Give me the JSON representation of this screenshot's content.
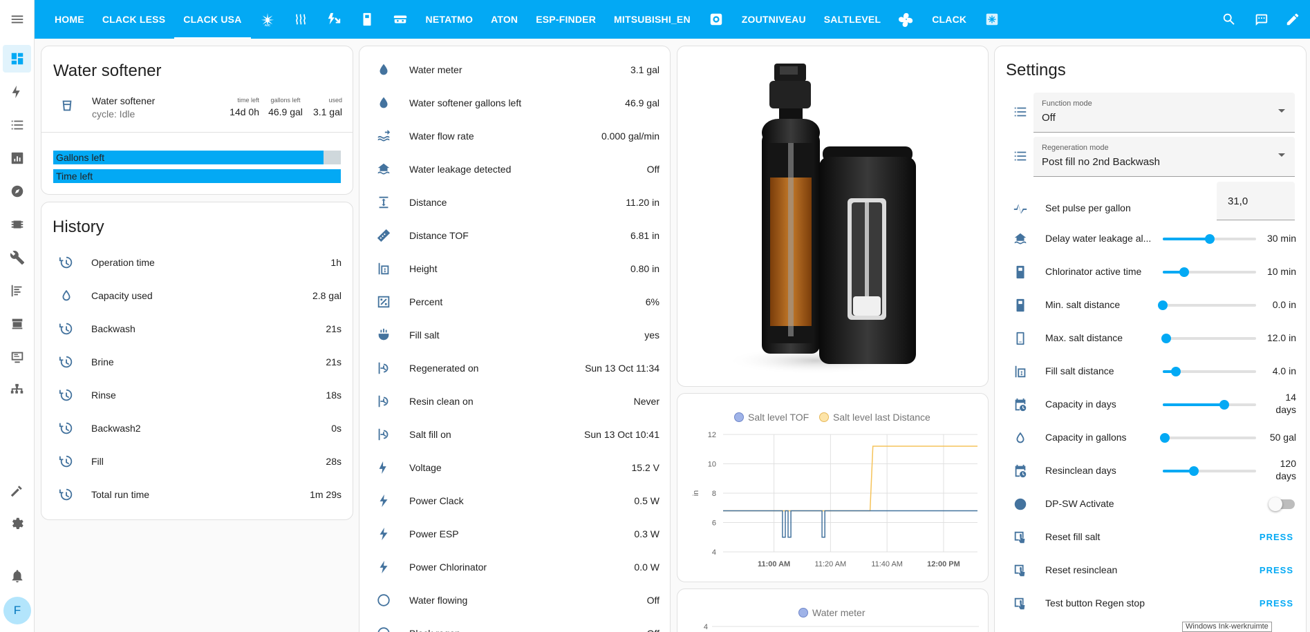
{
  "colors": {
    "accent": "#03a9f4",
    "icon": "#44739e",
    "series_tof": "#7aa6d8",
    "series_distance": "#f5c35a"
  },
  "tabs": [
    {
      "label": "HOME"
    },
    {
      "label": "CLACK LESS"
    },
    {
      "label": "CLACK USA",
      "active": true
    },
    {
      "icon": "ac-icon"
    },
    {
      "icon": "heating-icon"
    },
    {
      "icon": "power-icon"
    },
    {
      "icon": "device-icon"
    },
    {
      "icon": "robot-icon"
    },
    {
      "label": "NETATMO"
    },
    {
      "label": "ATON"
    },
    {
      "label": "ESP-FINDER"
    },
    {
      "label": "MITSUBISHI_EN"
    },
    {
      "icon": "camera-icon"
    },
    {
      "label": "ZOUTNIVEAU"
    },
    {
      "label": "SALTLEVEL"
    },
    {
      "icon": "fan-icon"
    },
    {
      "label": "CLACK"
    },
    {
      "icon": "box-icon"
    }
  ],
  "toolbar_icons": [
    "search-icon",
    "assist-icon",
    "edit-icon"
  ],
  "sidebar": {
    "items": [
      "dashboard-icon",
      "energy-icon",
      "logbook-icon",
      "history-icon",
      "map-icon",
      "esphome-icon",
      "tools-icon",
      "log-icon",
      "hacs-icon",
      "terminal-icon",
      "network-icon"
    ],
    "bottom": [
      "developer-tools-icon",
      "settings-icon",
      "notifications-icon"
    ],
    "avatar_initial": "F"
  },
  "water_softener": {
    "title": "Water softener",
    "entity_name": "Water softener",
    "cycle": "cycle: Idle",
    "stats": [
      {
        "label": "time left",
        "value": "14d 0h"
      },
      {
        "label": "gallons left",
        "value": "46.9 gal"
      },
      {
        "label": "used",
        "value": "3.1 gal"
      }
    ],
    "bars": [
      {
        "label": "Gallons left",
        "fraction": 0.94
      },
      {
        "label": "Time left",
        "fraction": 1.0
      }
    ]
  },
  "history": {
    "title": "History",
    "rows": [
      {
        "name": "Operation time",
        "value": "1h",
        "icon": "clock-icon"
      },
      {
        "name": "Capacity used",
        "value": "2.8 gal",
        "icon": "water-percent-icon"
      },
      {
        "name": "Backwash",
        "value": "21s",
        "icon": "clock-icon"
      },
      {
        "name": "Brine",
        "value": "21s",
        "icon": "clock-icon"
      },
      {
        "name": "Rinse",
        "value": "18s",
        "icon": "clock-icon"
      },
      {
        "name": "Backwash2",
        "value": "0s",
        "icon": "clock-icon"
      },
      {
        "name": "Fill",
        "value": "28s",
        "icon": "clock-icon"
      },
      {
        "name": "Total run time",
        "value": "1m 29s",
        "icon": "clock-icon"
      }
    ]
  },
  "sensors": [
    {
      "name": "Water meter",
      "value": "3.1 gal",
      "icon": "water-icon"
    },
    {
      "name": "Water softener gallons left",
      "value": "46.9 gal",
      "icon": "water-icon"
    },
    {
      "name": "Water flow rate",
      "value": "0.000 gal/min",
      "icon": "waves-arrow-icon"
    },
    {
      "name": "Water leakage detected",
      "value": "Off",
      "icon": "home-flood-icon"
    },
    {
      "name": "Distance",
      "value": "11.20 in",
      "icon": "distance-icon"
    },
    {
      "name": "Distance TOF",
      "value": "6.81 in",
      "icon": "ruler-icon"
    },
    {
      "name": "Height",
      "value": "0.80 in",
      "icon": "height-icon"
    },
    {
      "name": "Percent",
      "value": "6%",
      "icon": "percent-icon"
    },
    {
      "name": "Fill salt",
      "value": "yes",
      "icon": "fill-icon"
    },
    {
      "name": "Regenerated on",
      "value": "Sun 13 Oct 11:34",
      "icon": "clock-arrow-icon"
    },
    {
      "name": "Resin clean on",
      "value": "Never",
      "icon": "clock-arrow-icon"
    },
    {
      "name": "Salt fill on",
      "value": "Sun 13 Oct 10:41",
      "icon": "clock-arrow-icon"
    },
    {
      "name": "Voltage",
      "value": "15.2 V",
      "icon": "flash-icon"
    },
    {
      "name": "Power Clack",
      "value": "0.5 W",
      "icon": "power-flash-icon"
    },
    {
      "name": "Power ESP",
      "value": "0.3 W",
      "icon": "power-flash-icon"
    },
    {
      "name": "Power Chlorinator",
      "value": "0.0 W",
      "icon": "power-flash-icon"
    },
    {
      "name": "Water flowing",
      "value": "Off",
      "icon": "circle-icon"
    },
    {
      "name": "Block regen",
      "value": "Off",
      "icon": "circle-icon"
    }
  ],
  "settings": {
    "title": "Settings",
    "selects": [
      {
        "label": "Function mode",
        "value": "Off"
      },
      {
        "label": "Regeneration mode",
        "value": "Post fill no 2nd Backwash"
      }
    ],
    "pulse": {
      "name": "Set pulse per gallon",
      "value": "31,0"
    },
    "sliders": [
      {
        "name": "Delay water leakage al...",
        "value": "30 min",
        "fraction": 0.5,
        "icon": "home-flood-icon"
      },
      {
        "name": "Chlorinator active time",
        "value": "10 min",
        "fraction": 0.23,
        "icon": "device-icon"
      },
      {
        "name": "Min. salt distance",
        "value": "0.0 in",
        "fraction": 0.0,
        "icon": "device-icon"
      },
      {
        "name": "Max. salt distance",
        "value": "12.0 in",
        "fraction": 0.04,
        "icon": "device-outline-icon"
      },
      {
        "name": "Fill salt distance",
        "value": "4.0 in",
        "fraction": 0.14,
        "icon": "height-icon"
      },
      {
        "name": "Capacity in days",
        "value": "14",
        "value2": "days",
        "fraction": 0.66,
        "icon": "calendar-clock-icon"
      },
      {
        "name": "Capacity in gallons",
        "value": "50 gal",
        "fraction": 0.02,
        "icon": "water-percent-icon"
      },
      {
        "name": "Resinclean days",
        "value": "120",
        "value2": "days",
        "fraction": 0.33,
        "icon": "calendar-clock-icon"
      }
    ],
    "toggle": {
      "name": "DP-SW Activate",
      "on": false,
      "icon": "contrast-icon"
    },
    "buttons": [
      {
        "name": "Reset fill salt",
        "action": "PRESS",
        "icon": "gesture-tap-icon"
      },
      {
        "name": "Reset resinclean",
        "action": "PRESS",
        "icon": "gesture-tap-icon"
      },
      {
        "name": "Test button Regen stop",
        "action": "PRESS",
        "icon": "gesture-tap-icon"
      }
    ]
  },
  "chart_data": [
    {
      "type": "line",
      "title": "",
      "ylabel": "in",
      "ylim": [
        4,
        12
      ],
      "yticks": [
        4,
        6,
        8,
        10,
        12
      ],
      "xticks": [
        {
          "label": "11:00 AM",
          "bold": true
        },
        {
          "label": "11:20 AM",
          "bold": false
        },
        {
          "label": "11:40 AM",
          "bold": false
        },
        {
          "label": "12:00 PM",
          "bold": true
        }
      ],
      "x_range_minutes": [
        -18,
        72
      ],
      "series": [
        {
          "name": "Salt level TOF",
          "color": "#44739e",
          "x": [
            -18,
            3,
            3,
            4,
            4,
            5,
            5,
            6,
            6,
            17,
            17,
            18,
            18,
            72
          ],
          "y": [
            6.8,
            6.8,
            5.0,
            5.0,
            6.8,
            6.8,
            5.0,
            5.0,
            6.8,
            6.8,
            5.0,
            5.0,
            6.8,
            6.8
          ]
        },
        {
          "name": "Salt level last Distance",
          "color": "#f5c35a",
          "x": [
            -18,
            34,
            35,
            72
          ],
          "y": [
            6.8,
            6.8,
            11.2,
            11.2
          ]
        }
      ],
      "legend": "top"
    },
    {
      "type": "line",
      "title": "",
      "series": [
        {
          "name": "Water meter",
          "color": "#7aa6d8",
          "x": [],
          "y": []
        }
      ],
      "yticks_visible": [
        4
      ],
      "legend": "top"
    }
  ],
  "watermark_text": "Windows Ink-werkruimte"
}
